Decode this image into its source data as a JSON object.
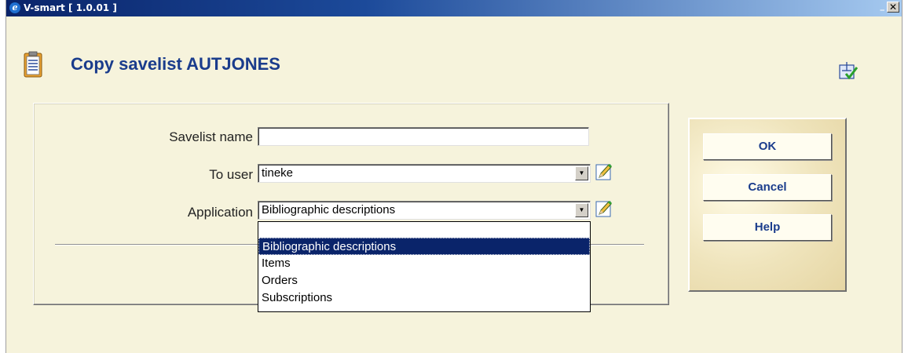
{
  "window": {
    "title": "V-smart [ 1.0.01 ]",
    "minimize_label": "_",
    "close_label": "✕"
  },
  "page": {
    "title": "Copy savelist AUTJONES"
  },
  "form": {
    "savelist_name": {
      "label": "Savelist name",
      "value": ""
    },
    "to_user": {
      "label": "To user",
      "value": "tineke"
    },
    "application": {
      "label": "Application",
      "value": "Bibliographic descriptions"
    }
  },
  "application_options": [
    "",
    "Bibliographic descriptions",
    "Items",
    "Orders",
    "Subscriptions"
  ],
  "application_selected_index": 1,
  "buttons": {
    "ok": "OK",
    "cancel": "Cancel",
    "help": "Help"
  },
  "icons": {
    "app": "clipboard-icon",
    "topright": "select-check-icon",
    "edit": "pencil-icon",
    "dropdown": "chevron-down-icon"
  },
  "colors": {
    "title_blue": "#1a3c8c",
    "background": "#f6f3dc",
    "selection": "#0a246a"
  }
}
